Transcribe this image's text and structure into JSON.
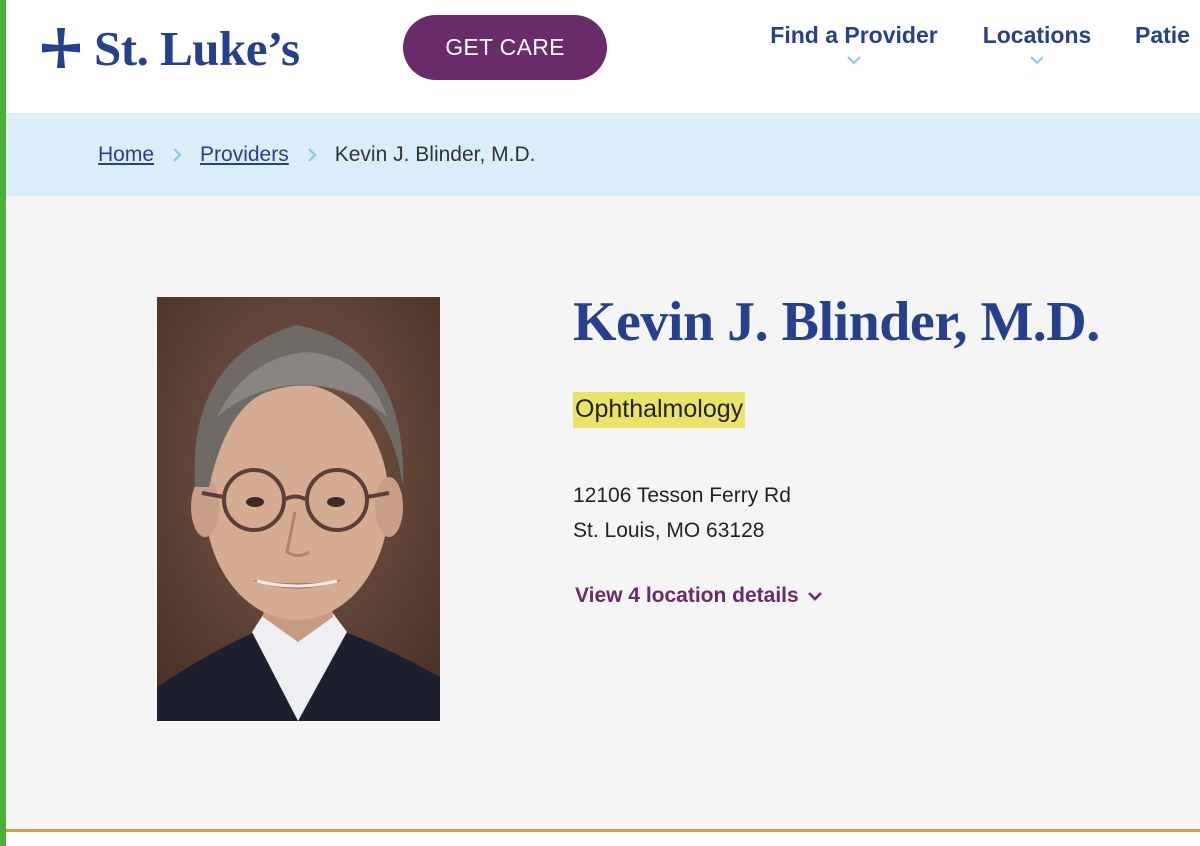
{
  "header": {
    "logo_text": "St. Luke’s",
    "cta_label": "GET CARE",
    "nav": [
      {
        "label": "Find a Provider"
      },
      {
        "label": "Locations"
      },
      {
        "label": "Patie"
      }
    ]
  },
  "breadcrumb": {
    "items": [
      "Home",
      "Providers"
    ],
    "current": "Kevin J. Blinder, M.D."
  },
  "provider": {
    "name": "Kevin J. Blinder, M.D.",
    "specialty": "Ophthalmology",
    "address_line1": "12106 Tesson Ferry Rd",
    "address_line2": "St. Louis, MO 63128",
    "locations_link": "View 4 location details"
  },
  "colors": {
    "brand_blue": "#27408b",
    "brand_purple": "#6a2b6b",
    "breadcrumb_bg": "#dbeefb",
    "highlight": "#e9e36a",
    "accent_orange": "#e09a4e",
    "edge_green": "#4caf3a"
  },
  "icons": {
    "logo": "cross-icon",
    "nav_dropdown": "chevron-down-icon",
    "breadcrumb_separator": "chevron-right-icon",
    "toggle": "chevron-down-icon"
  }
}
